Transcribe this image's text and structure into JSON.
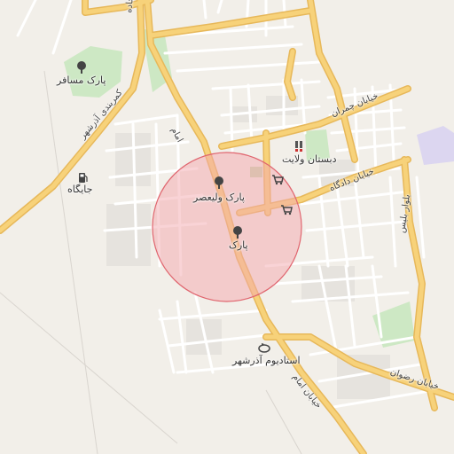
{
  "map": {
    "labels": {
      "park_mosafer": "پارک مسافر",
      "gas_station": "جایگاه",
      "park_valiasr": "پارک ولیعصر",
      "park": "پارک",
      "school_velayat": "دبستان ولایت",
      "stadium": "استادیوم آذرشهر"
    },
    "roads": {
      "jadeh": "جاده",
      "kamarbandi": "کمربندی آذرشهر",
      "imam": "امام",
      "imam_street": "خیابان امام",
      "chamran": "خیابان چمران",
      "dadgah": "خیابان دادگاه",
      "rezvan": "خیابان رضوان",
      "bolvar": "بلوار بلیس"
    },
    "icons": [
      "tree-icon",
      "fuel-icon",
      "school-icon",
      "cart-icon",
      "stadium-icon"
    ],
    "colors": {
      "land": "#f2efe9",
      "major_road": "#f7d27a",
      "minor_road": "#ffffff",
      "park": "#cde8c4",
      "circle_fill": "#f4a7ad",
      "circle_stroke": "#e0666f",
      "residential": "#e6e3de",
      "purple_area": "#dcd6f0"
    }
  }
}
